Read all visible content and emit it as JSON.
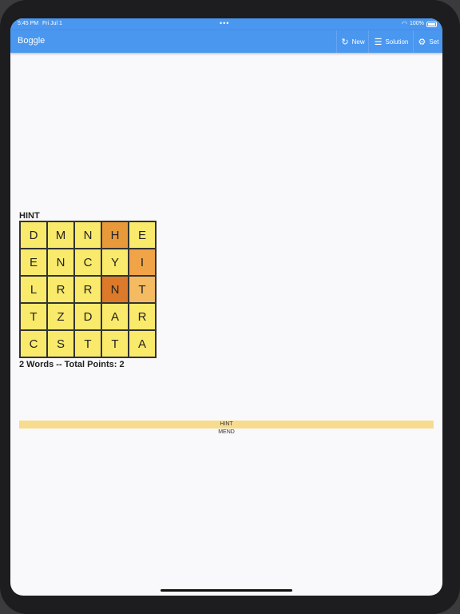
{
  "status": {
    "time": "5:45 PM",
    "date": "Fri Jul 1",
    "dots": "•••",
    "battery": "100%"
  },
  "appbar": {
    "title": "Boggle",
    "actions": [
      {
        "label": "New",
        "icon": "refresh-icon"
      },
      {
        "label": "Solution",
        "icon": "checklist-icon"
      },
      {
        "label": "Set",
        "icon": "gear-icon"
      }
    ]
  },
  "hint_label": "HINT",
  "board": {
    "rows": [
      [
        "D",
        "M",
        "N",
        "H",
        "E"
      ],
      [
        "E",
        "N",
        "C",
        "Y",
        "I"
      ],
      [
        "L",
        "R",
        "R",
        "N",
        "T"
      ],
      [
        "T",
        "Z",
        "D",
        "A",
        "R"
      ],
      [
        "C",
        "S",
        "T",
        "T",
        "A"
      ]
    ],
    "highlights": [
      {
        "row": 0,
        "col": 3,
        "color": "#e89a3a"
      },
      {
        "row": 1,
        "col": 4,
        "color": "#f0a447"
      },
      {
        "row": 2,
        "col": 3,
        "color": "#dc7a2a"
      },
      {
        "row": 2,
        "col": 4,
        "color": "#f4bb62"
      }
    ]
  },
  "summary": "2 Words  --  Total Points: 2",
  "hint_button": "HINT",
  "hint_word": "MEND"
}
